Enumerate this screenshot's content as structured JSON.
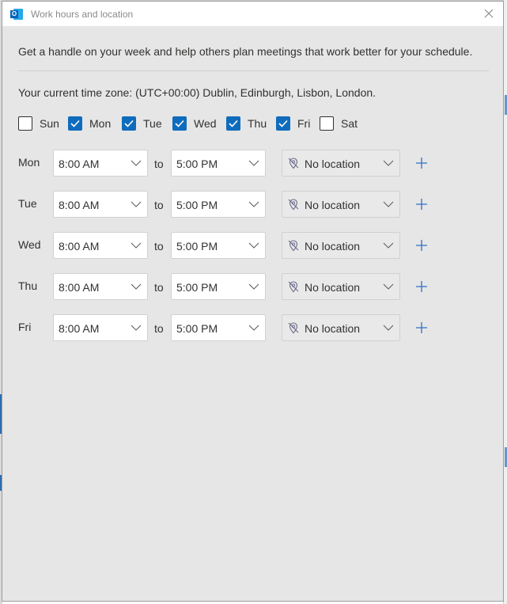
{
  "window": {
    "title": "Work hours and location",
    "app_icon": "outlook-icon",
    "close_icon": "close-icon"
  },
  "intro": "Get a handle on your week and help others plan meetings that work better for your schedule.",
  "timezone": "Your current time zone: (UTC+00:00) Dublin, Edinburgh, Lisbon, London.",
  "days": [
    {
      "label": "Sun",
      "checked": false
    },
    {
      "label": "Mon",
      "checked": true
    },
    {
      "label": "Tue",
      "checked": true
    },
    {
      "label": "Wed",
      "checked": true
    },
    {
      "label": "Thu",
      "checked": true
    },
    {
      "label": "Fri",
      "checked": true
    },
    {
      "label": "Sat",
      "checked": false
    }
  ],
  "schedule": [
    {
      "day": "Mon",
      "start": "8:00 AM",
      "to": "to",
      "end": "5:00 PM",
      "location": "No location"
    },
    {
      "day": "Tue",
      "start": "8:00 AM",
      "to": "to",
      "end": "5:00 PM",
      "location": "No location"
    },
    {
      "day": "Wed",
      "start": "8:00 AM",
      "to": "to",
      "end": "5:00 PM",
      "location": "No location"
    },
    {
      "day": "Thu",
      "start": "8:00 AM",
      "to": "to",
      "end": "5:00 PM",
      "location": "No location"
    },
    {
      "day": "Fri",
      "start": "8:00 AM",
      "to": "to",
      "end": "5:00 PM",
      "location": "No location"
    }
  ],
  "colors": {
    "accent": "#0f6cbd",
    "add_icon": "#2f6fc4",
    "dialog_bg": "#e6e6e6"
  },
  "icons": {
    "dropdown": "chevron-down-icon",
    "location": "location-off-icon",
    "add": "add-icon",
    "check": "checkmark-icon"
  }
}
